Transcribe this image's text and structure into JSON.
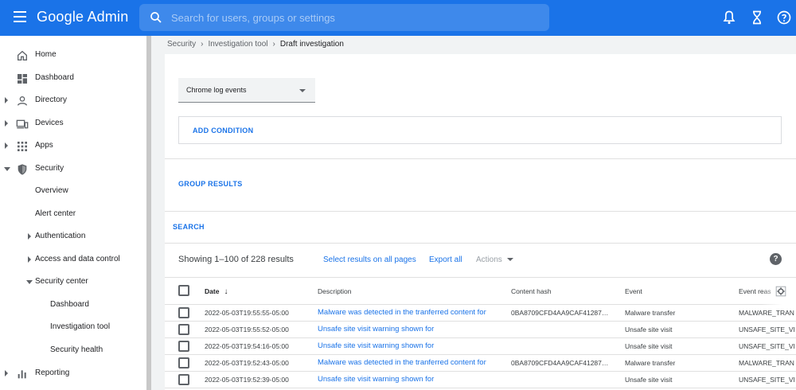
{
  "header": {
    "title": "Google Admin",
    "search_placeholder": "Search for users, groups or settings"
  },
  "sidebar": {
    "items": [
      {
        "label": "Home",
        "icon": "home-icon"
      },
      {
        "label": "Dashboard",
        "icon": "dashboard-icon"
      },
      {
        "label": "Directory",
        "icon": "person-icon"
      },
      {
        "label": "Devices",
        "icon": "devices-icon"
      },
      {
        "label": "Apps",
        "icon": "apps-grid-icon"
      },
      {
        "label": "Security",
        "icon": "shield-icon"
      },
      {
        "label": "Overview"
      },
      {
        "label": "Alert center"
      },
      {
        "label": "Authentication"
      },
      {
        "label": "Access and data control"
      },
      {
        "label": "Security center"
      },
      {
        "label": "Dashboard"
      },
      {
        "label": "Investigation tool"
      },
      {
        "label": "Security health"
      },
      {
        "label": "Reporting",
        "icon": "bar-chart-icon"
      }
    ]
  },
  "breadcrumb": [
    "Security",
    "Investigation tool",
    "Draft investigation"
  ],
  "main": {
    "data_source": "Chrome log events",
    "add_condition": "ADD CONDITION",
    "group_results": "GROUP RESULTS",
    "search": "SEARCH",
    "results_summary": "Showing 1–100 of 228 results",
    "select_all_link": "Select results on all pages",
    "export_link": "Export all",
    "actions_label": "Actions"
  },
  "table": {
    "columns": {
      "date": "Date",
      "description": "Description",
      "content_hash": "Content hash",
      "event": "Event",
      "event_reason": "Event reas"
    },
    "rows": [
      {
        "date": "2022-05-03T19:55:55-05:00",
        "description": "Malware was detected in the tranferred content for",
        "hash": "0BA8709CFD4AA9CAF41287…",
        "event": "Malware transfer",
        "reason": "MALWARE_TRAN"
      },
      {
        "date": "2022-05-03T19:55:52-05:00",
        "description": "Unsafe site visit warning shown for",
        "hash": "",
        "event": "Unsafe site visit",
        "reason": "UNSAFE_SITE_VI"
      },
      {
        "date": "2022-05-03T19:54:16-05:00",
        "description": "Unsafe site visit warning shown for",
        "hash": "",
        "event": "Unsafe site visit",
        "reason": "UNSAFE_SITE_VI"
      },
      {
        "date": "2022-05-03T19:52:43-05:00",
        "description": "Malware was detected in the tranferred content for",
        "hash": "0BA8709CFD4AA9CAF41287…",
        "event": "Malware transfer",
        "reason": "MALWARE_TRAN"
      },
      {
        "date": "2022-05-03T19:52:39-05:00",
        "description": "Unsafe site visit warning shown for",
        "hash": "",
        "event": "Unsafe site visit",
        "reason": "UNSAFE_SITE_VI"
      }
    ]
  },
  "colors": {
    "brand": "#1a73e8",
    "link": "#1a73e8",
    "text": "#202124"
  }
}
